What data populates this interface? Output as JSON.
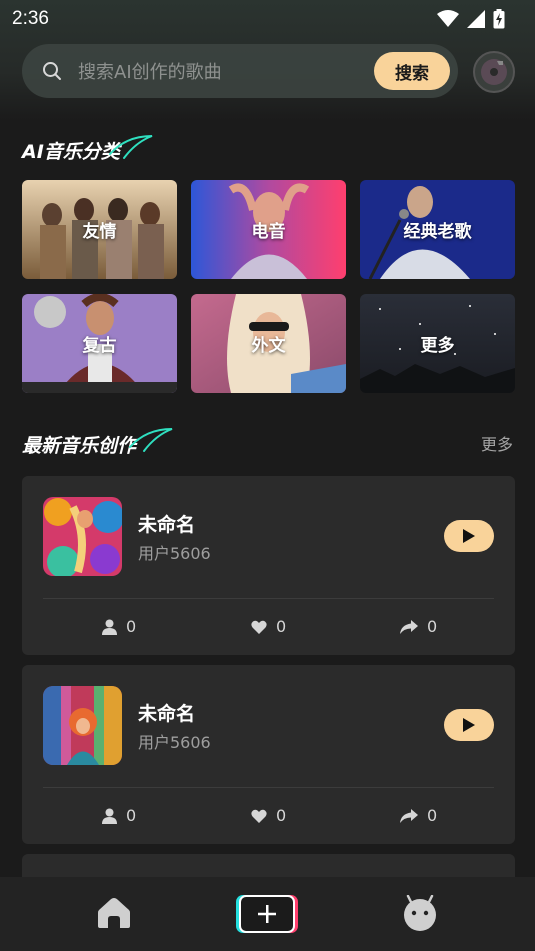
{
  "status_bar": {
    "time": "2:36"
  },
  "search": {
    "placeholder": "搜索AI创作的歌曲",
    "button_label": "搜索"
  },
  "categories_section": {
    "title": "AI音乐分类",
    "items": [
      {
        "label": "友情"
      },
      {
        "label": "电音"
      },
      {
        "label": "经典老歌"
      },
      {
        "label": "复古"
      },
      {
        "label": "外文"
      },
      {
        "label": "更多"
      }
    ]
  },
  "latest_section": {
    "title": "最新音乐创作",
    "more_label": "更多",
    "songs": [
      {
        "title": "未命名",
        "author": "用户5606",
        "listeners": "0",
        "likes": "0",
        "shares": "0"
      },
      {
        "title": "未命名",
        "author": "用户5606",
        "listeners": "0",
        "likes": "0",
        "shares": "0"
      }
    ]
  },
  "bottom_nav": {
    "items": [
      "home-icon",
      "create-icon",
      "profile-icon"
    ]
  },
  "colors": {
    "accent": "#f9d39a",
    "background": "#1b1b1b",
    "card": "#2b2b2b"
  }
}
